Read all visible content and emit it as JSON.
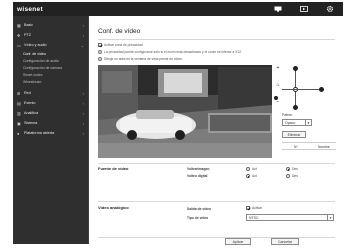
{
  "header": {
    "logo": "wisenet",
    "icons": [
      "monitor-icon",
      "play-icon",
      "gear-icon"
    ]
  },
  "sidebar": {
    "items": [
      {
        "label": "Basic",
        "icon": "grid-icon"
      },
      {
        "label": "PTZ",
        "icon": "move-icon"
      },
      {
        "label": "Vídeo y audio",
        "icon": "video-icon",
        "expanded": true
      },
      {
        "label": "Red",
        "icon": "network-icon"
      },
      {
        "label": "Evento",
        "icon": "event-icon"
      },
      {
        "label": "Analítica",
        "icon": "analytics-icon"
      },
      {
        "label": "Sistema",
        "icon": "system-icon"
      },
      {
        "label": "Plataforma abierta",
        "icon": "platform-icon"
      }
    ],
    "sub_items": [
      {
        "label": "Conf. de vídeo",
        "active": true
      },
      {
        "label": "Configuración de audio"
      },
      {
        "label": "Configuración de cámara"
      },
      {
        "label": "Smart codec"
      },
      {
        "label": "Wisestream"
      }
    ]
  },
  "main": {
    "title": "Conf. de vídeo",
    "privacy_checkbox_label": "Activar zona de privacidad",
    "privacy_checked": true,
    "info_line_1": "La privacidad puede configurarse sólo si el zoom está desactivado y el zoom es inferior a X12.",
    "info_line_2": "Dibuje un área en la ventana de vista previa de vídeo.",
    "pattern_label": "Patrón",
    "pattern_value": "Opaco",
    "delete_button": "Eliminar",
    "grid_col_no": "Nº",
    "grid_col_name": "Nombre",
    "video_source": {
      "section": "Fuente de vídeo",
      "rows": [
        {
          "label": "Voltearimagen",
          "options": [
            "Act",
            "Des"
          ],
          "selected": "Des"
        },
        {
          "label": "Volteo digital",
          "options": [
            "Act",
            "Des"
          ],
          "selected": "Act"
        }
      ]
    },
    "analog_video": {
      "section": "Vídeo analógico",
      "output_label": "Salida de vídeo",
      "output_checkbox_label": "Activar",
      "output_checked": true,
      "type_label": "Tipo de vídeo",
      "type_value": "NTSC"
    },
    "apply_button": "Aplicar",
    "cancel_button": "Cancelar"
  }
}
